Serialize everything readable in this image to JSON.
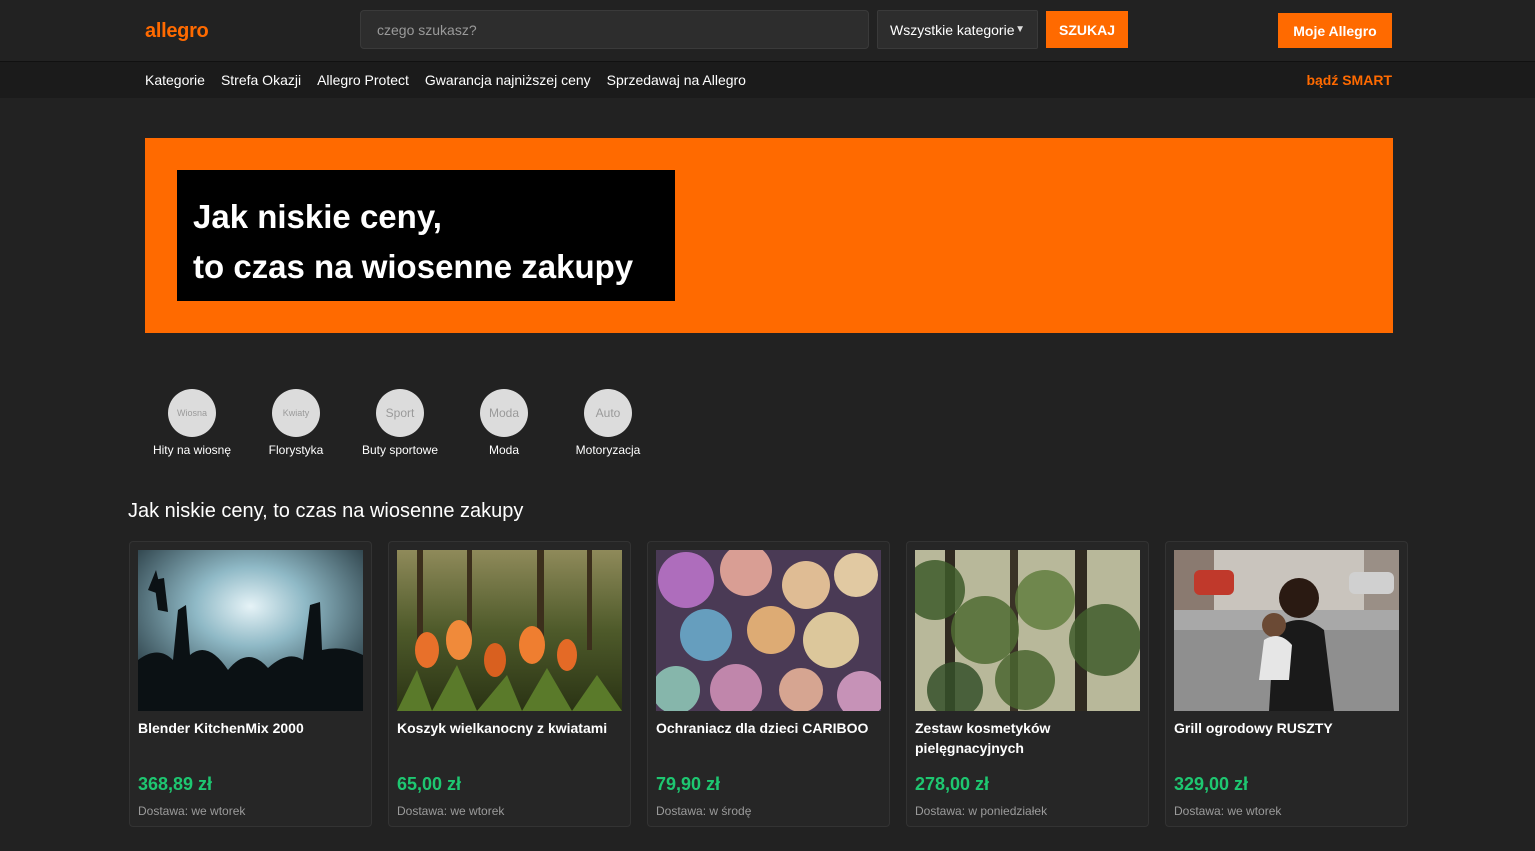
{
  "header": {
    "logo": "allegro",
    "search_placeholder": "czego szukasz?",
    "category_select": "Wszystkie kategorie",
    "search_button": "SZUKAJ",
    "account_button": "Moje Allegro"
  },
  "nav": {
    "links": [
      "Kategorie",
      "Strefa Okazji",
      "Allegro Protect",
      "Gwarancja najniższej ceny",
      "Sprzedawaj na Allegro"
    ],
    "smart": "bądź SMART"
  },
  "banner": {
    "line1": "Jak niskie ceny,",
    "line2": "to czas na wiosenne zakupy"
  },
  "categories": [
    {
      "icon_text": "Wiosna",
      "label": "Hity na wiosnę"
    },
    {
      "icon_text": "Kwiaty",
      "label": "Florystyka"
    },
    {
      "icon_text": "Sport",
      "label": "Buty sportowe"
    },
    {
      "icon_text": "Moda",
      "label": "Moda"
    },
    {
      "icon_text": "Auto",
      "label": "Motoryzacja"
    }
  ],
  "section_title": "Jak niskie ceny, to czas na wiosenne zakupy",
  "products": [
    {
      "title": "Blender KitchenMix 2000",
      "price": "368,89 zł",
      "delivery": "Dostawa: we wtorek",
      "image": "concert-crowd-photo"
    },
    {
      "title": "Koszyk wielkanocny z kwiatami",
      "price": "65,00 zł",
      "delivery": "Dostawa: we wtorek",
      "image": "tulips-photo"
    },
    {
      "title": "Ochraniacz dla dzieci CARIBOO",
      "price": "79,90 zł",
      "delivery": "Dostawa: w środę",
      "image": "bokeh-lights-photo"
    },
    {
      "title": "Zestaw kosmetyków pielęgnacyjnych",
      "price": "278,00 zł",
      "delivery": "Dostawa: w poniedziałek",
      "image": "forest-photo"
    },
    {
      "title": "Grill ogrodowy RUSZTY",
      "price": "329,00 zł",
      "delivery": "Dostawa: we wtorek",
      "image": "mother-child-street-photo"
    }
  ],
  "colors": {
    "accent": "#ff6a00",
    "background": "#222222",
    "price": "#1ec771"
  }
}
